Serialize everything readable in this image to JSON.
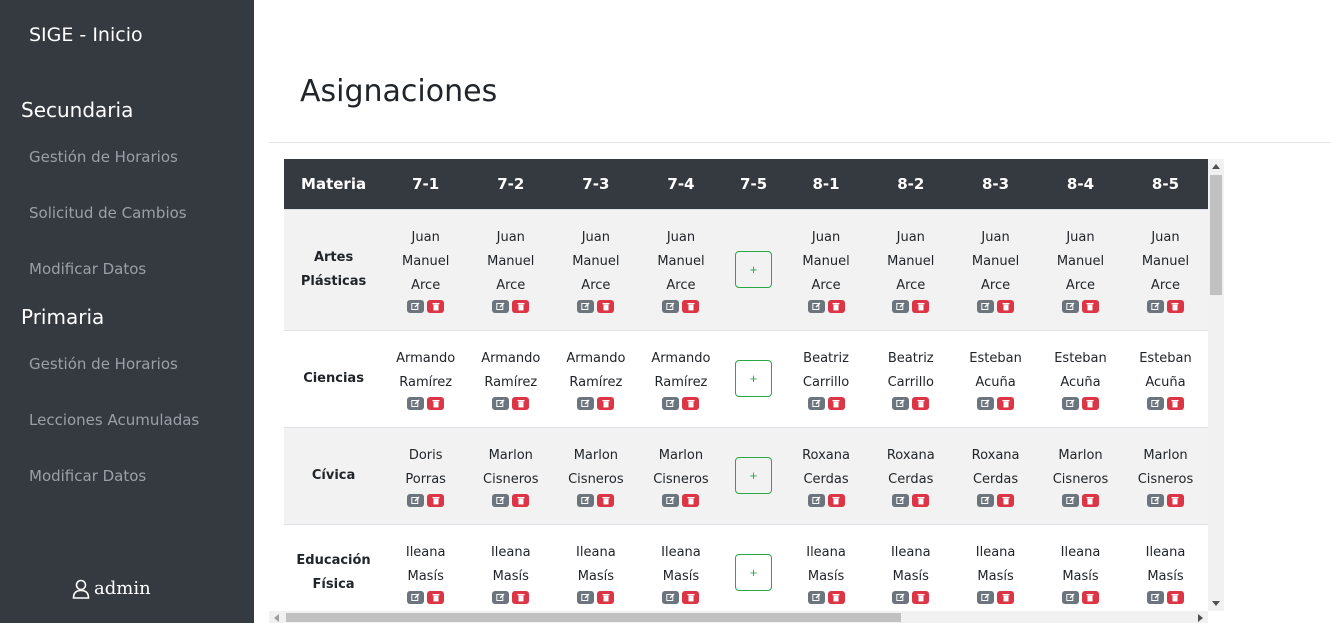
{
  "sidebar": {
    "brand": "SIGE - Inicio",
    "sections": [
      {
        "title": "Secundaria",
        "items": [
          "Gestión de Horarios",
          "Solicitud de Cambios",
          "Modificar Datos"
        ]
      },
      {
        "title": "Primaria",
        "items": [
          "Gestión de Horarios",
          "Lecciones Acumuladas",
          "Modificar Datos"
        ]
      }
    ],
    "user": "admin",
    "user_icon": "user-icon"
  },
  "page": {
    "title": "Asignaciones"
  },
  "table": {
    "headers": [
      "Materia",
      "7-1",
      "7-2",
      "7-3",
      "7-4",
      "7-5",
      "8-1",
      "8-2",
      "8-3",
      "8-4",
      "8-5"
    ],
    "add_label": "+",
    "rows": [
      {
        "subject": [
          "Artes",
          "Plásticas"
        ],
        "cells": [
          [
            "Juan",
            "Manuel",
            "Arce"
          ],
          [
            "Juan",
            "Manuel",
            "Arce"
          ],
          [
            "Juan",
            "Manuel",
            "Arce"
          ],
          [
            "Juan",
            "Manuel",
            "Arce"
          ],
          null,
          [
            "Juan",
            "Manuel",
            "Arce"
          ],
          [
            "Juan",
            "Manuel",
            "Arce"
          ],
          [
            "Juan",
            "Manuel",
            "Arce"
          ],
          [
            "Juan",
            "Manuel",
            "Arce"
          ],
          [
            "Juan",
            "Manuel",
            "Arce"
          ]
        ]
      },
      {
        "subject": [
          "Ciencias"
        ],
        "cells": [
          [
            "Armando",
            "Ramírez"
          ],
          [
            "Armando",
            "Ramírez"
          ],
          [
            "Armando",
            "Ramírez"
          ],
          [
            "Armando",
            "Ramírez"
          ],
          null,
          [
            "Beatriz",
            "Carrillo"
          ],
          [
            "Beatriz",
            "Carrillo"
          ],
          [
            "Esteban",
            "Acuña"
          ],
          [
            "Esteban",
            "Acuña"
          ],
          [
            "Esteban",
            "Acuña"
          ]
        ]
      },
      {
        "subject": [
          "Cívica"
        ],
        "cells": [
          [
            "Doris",
            "Porras"
          ],
          [
            "Marlon",
            "Cisneros"
          ],
          [
            "Marlon",
            "Cisneros"
          ],
          [
            "Marlon",
            "Cisneros"
          ],
          null,
          [
            "Roxana",
            "Cerdas"
          ],
          [
            "Roxana",
            "Cerdas"
          ],
          [
            "Roxana",
            "Cerdas"
          ],
          [
            "Marlon",
            "Cisneros"
          ],
          [
            "Marlon",
            "Cisneros"
          ]
        ]
      },
      {
        "subject": [
          "Educación",
          "Física"
        ],
        "cells": [
          [
            "Ileana",
            "Masís"
          ],
          [
            "Ileana",
            "Masís"
          ],
          [
            "Ileana",
            "Masís"
          ],
          [
            "Ileana",
            "Masís"
          ],
          null,
          [
            "Ileana",
            "Masís"
          ],
          [
            "Ileana",
            "Masís"
          ],
          [
            "Ileana",
            "Masís"
          ],
          [
            "Ileana",
            "Masís"
          ],
          [
            "Ileana",
            "Masís"
          ]
        ]
      }
    ]
  },
  "colors": {
    "sidebar_bg": "#343a40",
    "edit": "#6c757d",
    "delete": "#dc3545",
    "add": "#28a745"
  }
}
